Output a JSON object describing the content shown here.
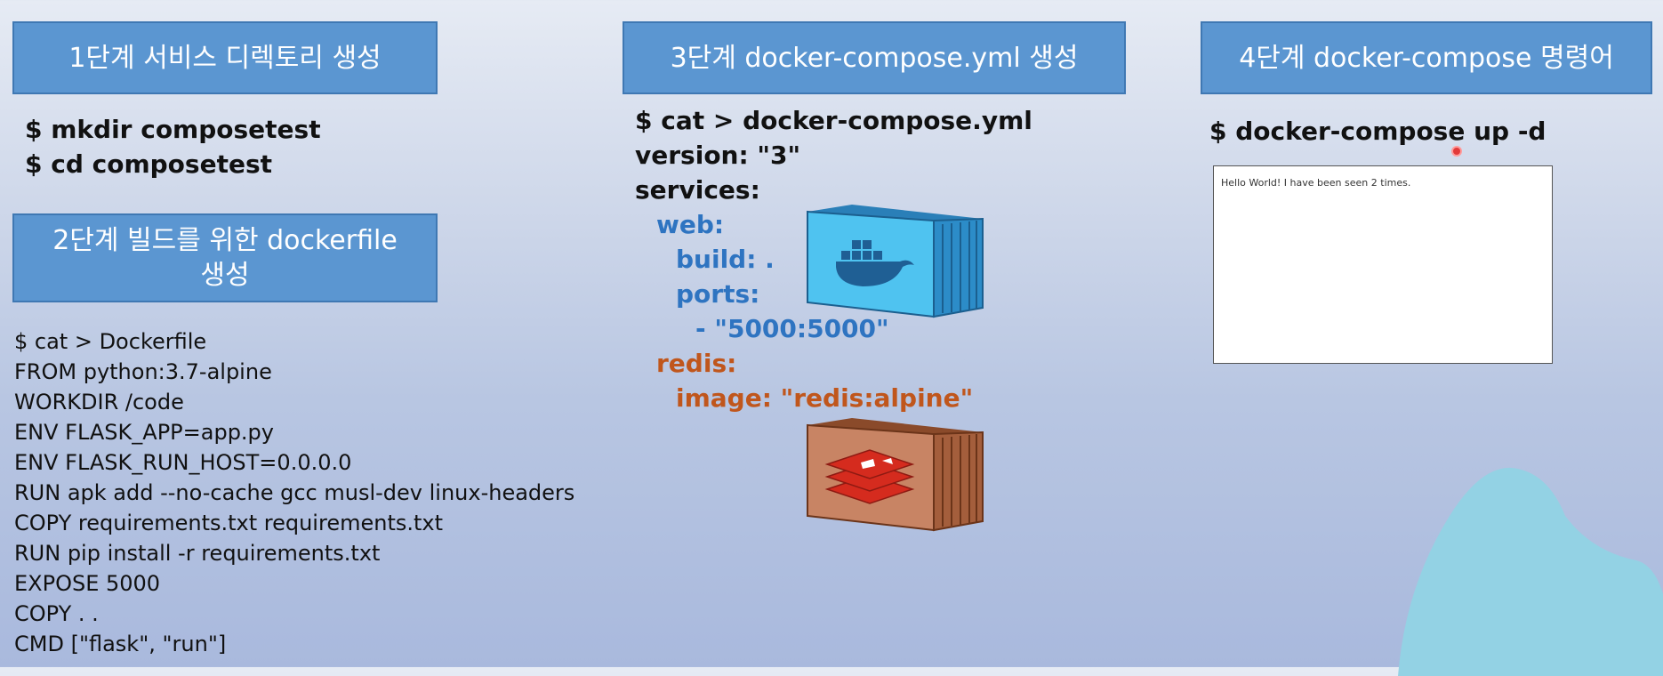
{
  "step1": {
    "title": "1단계 서비스 디렉토리 생성",
    "commands": [
      "$ mkdir composetest",
      "$ cd composetest"
    ]
  },
  "step2": {
    "title_line1": "2단계 빌드를 위한 dockerfile",
    "title_line2": "생성",
    "lines": [
      "$ cat > Dockerfile",
      "FROM python:3.7-alpine",
      "WORKDIR /code",
      "ENV FLASK_APP=app.py",
      "ENV FLASK_RUN_HOST=0.0.0.0",
      "RUN apk add --no-cache gcc musl-dev linux-headers",
      "COPY requirements.txt requirements.txt",
      "RUN pip install -r requirements.txt",
      "EXPOSE 5000",
      "COPY . .",
      "CMD [\"flask\", \"run\"]"
    ]
  },
  "step3": {
    "title": "3단계 docker-compose.yml 생성",
    "yml": {
      "cmd": "$ cat > docker-compose.yml",
      "version": "version: \"3\"",
      "services": "services:",
      "web": "web:",
      "build": "build: .",
      "ports": "ports:",
      "port_value": "- \"5000:5000\"",
      "redis": "redis:",
      "image": "image: \"redis:alpine\""
    }
  },
  "step4": {
    "title": "4단계 docker-compose 명령어",
    "command": "$ docker-compose up -d",
    "browser_text": "Hello World! I have been seen 2 times."
  },
  "colors": {
    "step_box": "#5b96d1",
    "web_service": "#2e74c1",
    "redis_service": "#c0561c"
  },
  "icons": {
    "docker_container": "docker-container-icon",
    "redis_container": "redis-container-icon"
  }
}
